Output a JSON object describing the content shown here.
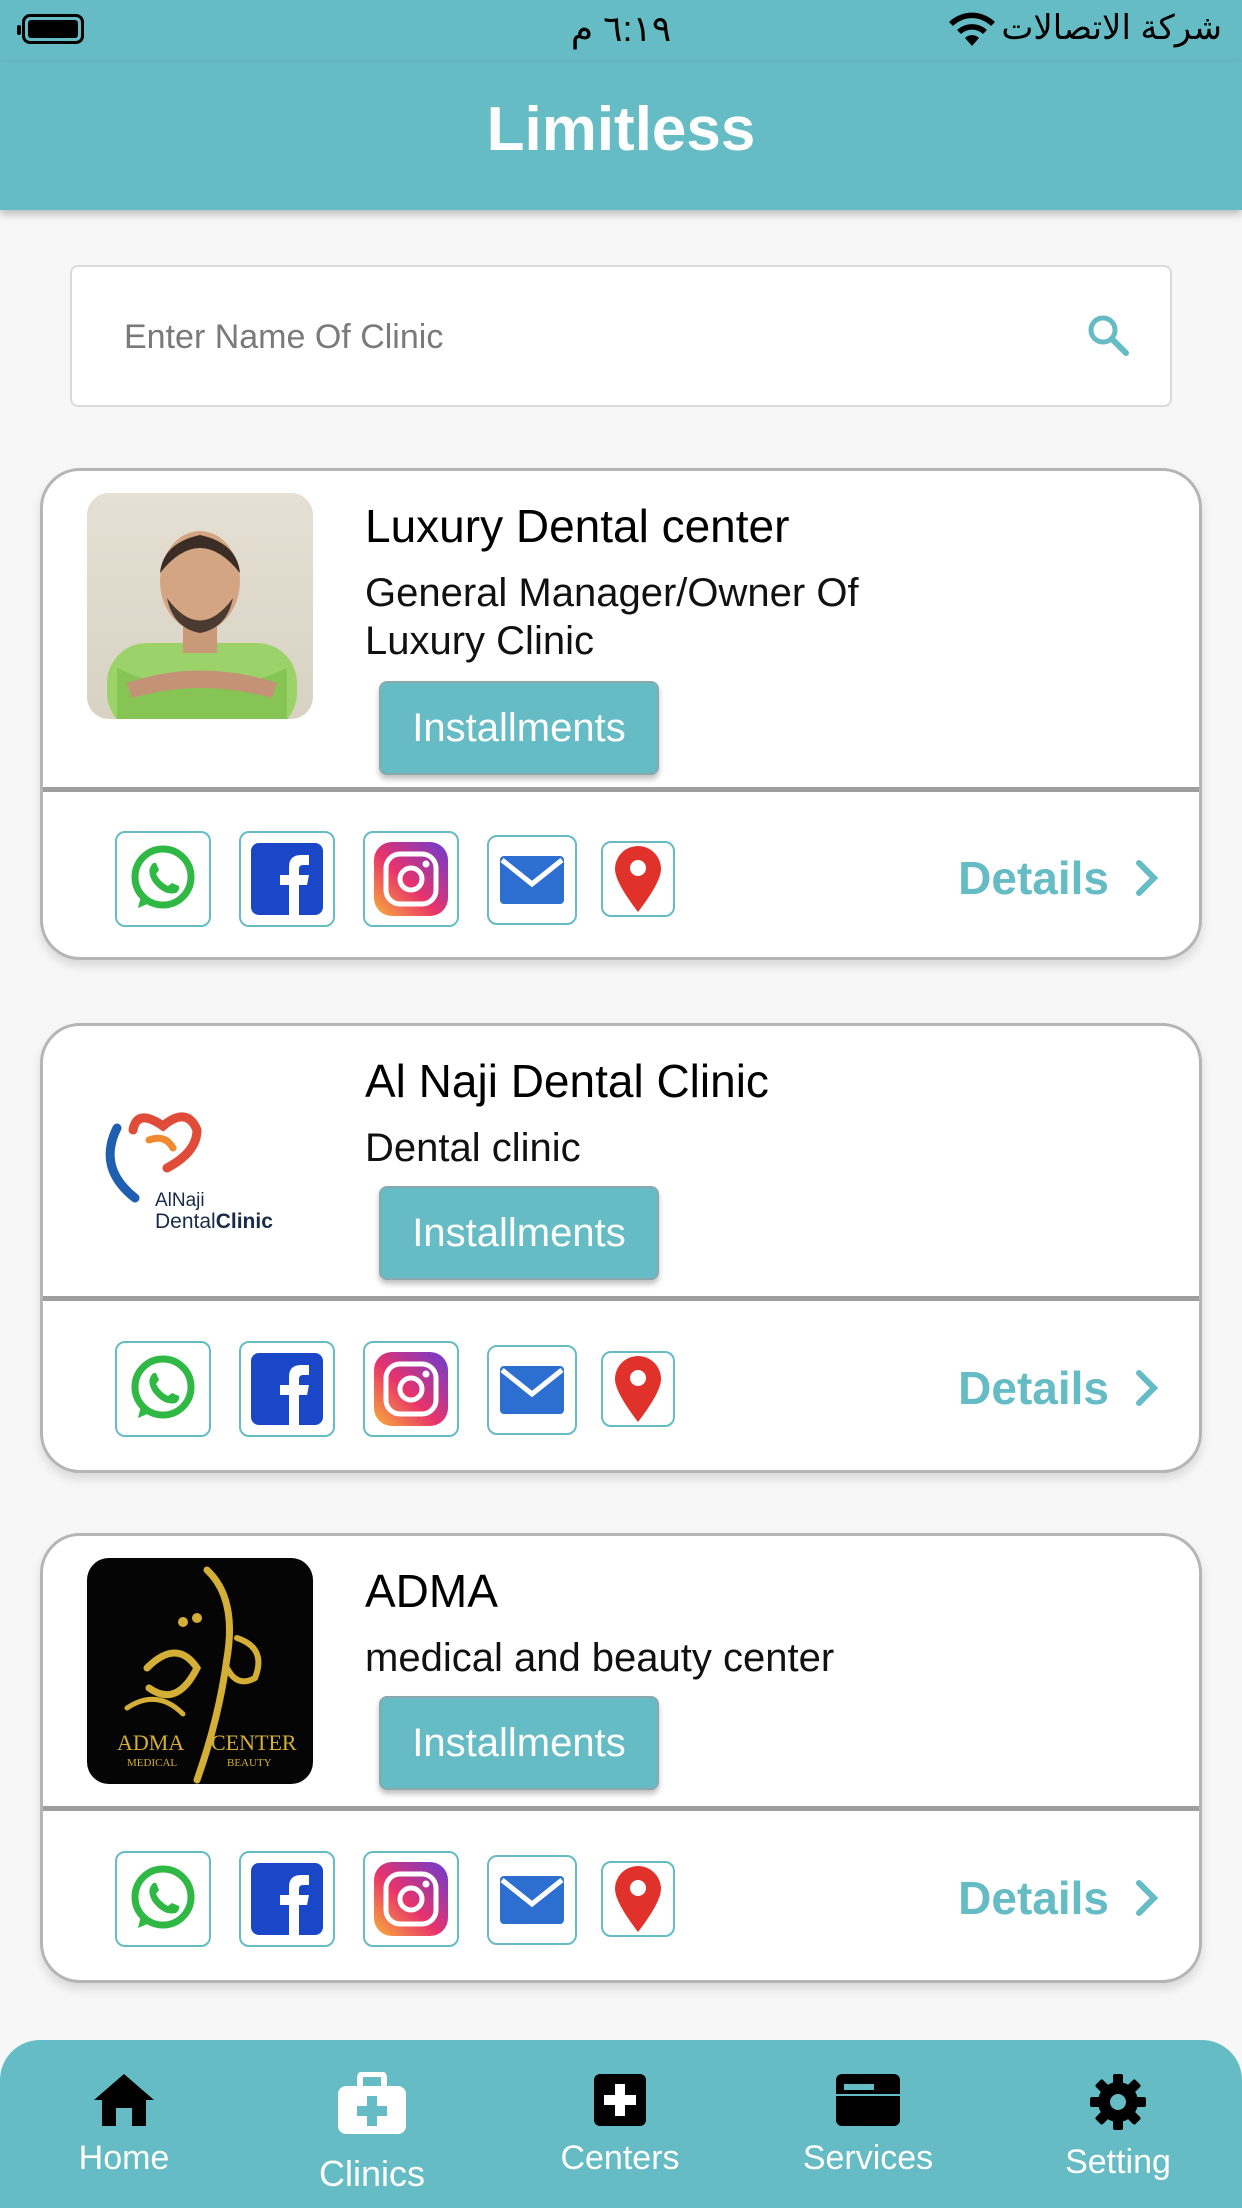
{
  "status_bar": {
    "time": "٦:١٩ م",
    "carrier": "شركة الاتصالات",
    "wifi_icon": "wifi-icon",
    "battery_icon": "battery-icon"
  },
  "header": {
    "title": "Limitless"
  },
  "search": {
    "placeholder": "Enter Name Of Clinic",
    "value": "",
    "icon": "search-icon"
  },
  "clinics": [
    {
      "name": "Luxury Dental center",
      "description": "General Manager/Owner Of Luxury Clinic",
      "installments_label": "Installments",
      "details_label": "Details",
      "image": "clinic-owner-photo"
    },
    {
      "name": "Al Naji Dental Clinic",
      "description": "Dental clinic",
      "installments_label": "Installments",
      "details_label": "Details",
      "image": "al-naji-logo",
      "logo_text_line1": "AlNaji",
      "logo_text_line2a": "Dental",
      "logo_text_line2b": "Clinic"
    },
    {
      "name": "ADMA",
      "description": "medical and beauty center",
      "installments_label": "Installments",
      "details_label": "Details",
      "image": "adma-logo",
      "logo_text_line1": "ADMA",
      "logo_text_line1b": "CENTER",
      "logo_text_line2": "MEDICAL",
      "logo_text_line2b": "BEAUTY"
    }
  ],
  "social_icons": [
    "whatsapp-icon",
    "facebook-icon",
    "instagram-icon",
    "email-icon",
    "location-pin-icon"
  ],
  "bottom_nav": {
    "items": [
      {
        "label": "Home",
        "icon": "home-icon"
      },
      {
        "label": "Clinics",
        "icon": "briefcase-medical-icon",
        "active": true
      },
      {
        "label": "Centers",
        "icon": "plus-square-icon"
      },
      {
        "label": "Services",
        "icon": "card-icon"
      },
      {
        "label": "Setting",
        "icon": "gear-icon"
      }
    ]
  },
  "colors": {
    "primary": "#66bcc4",
    "whatsapp": "#2fb843",
    "facebook": "#1a47c8",
    "email": "#2c6fd0",
    "location": "#e0322b"
  }
}
